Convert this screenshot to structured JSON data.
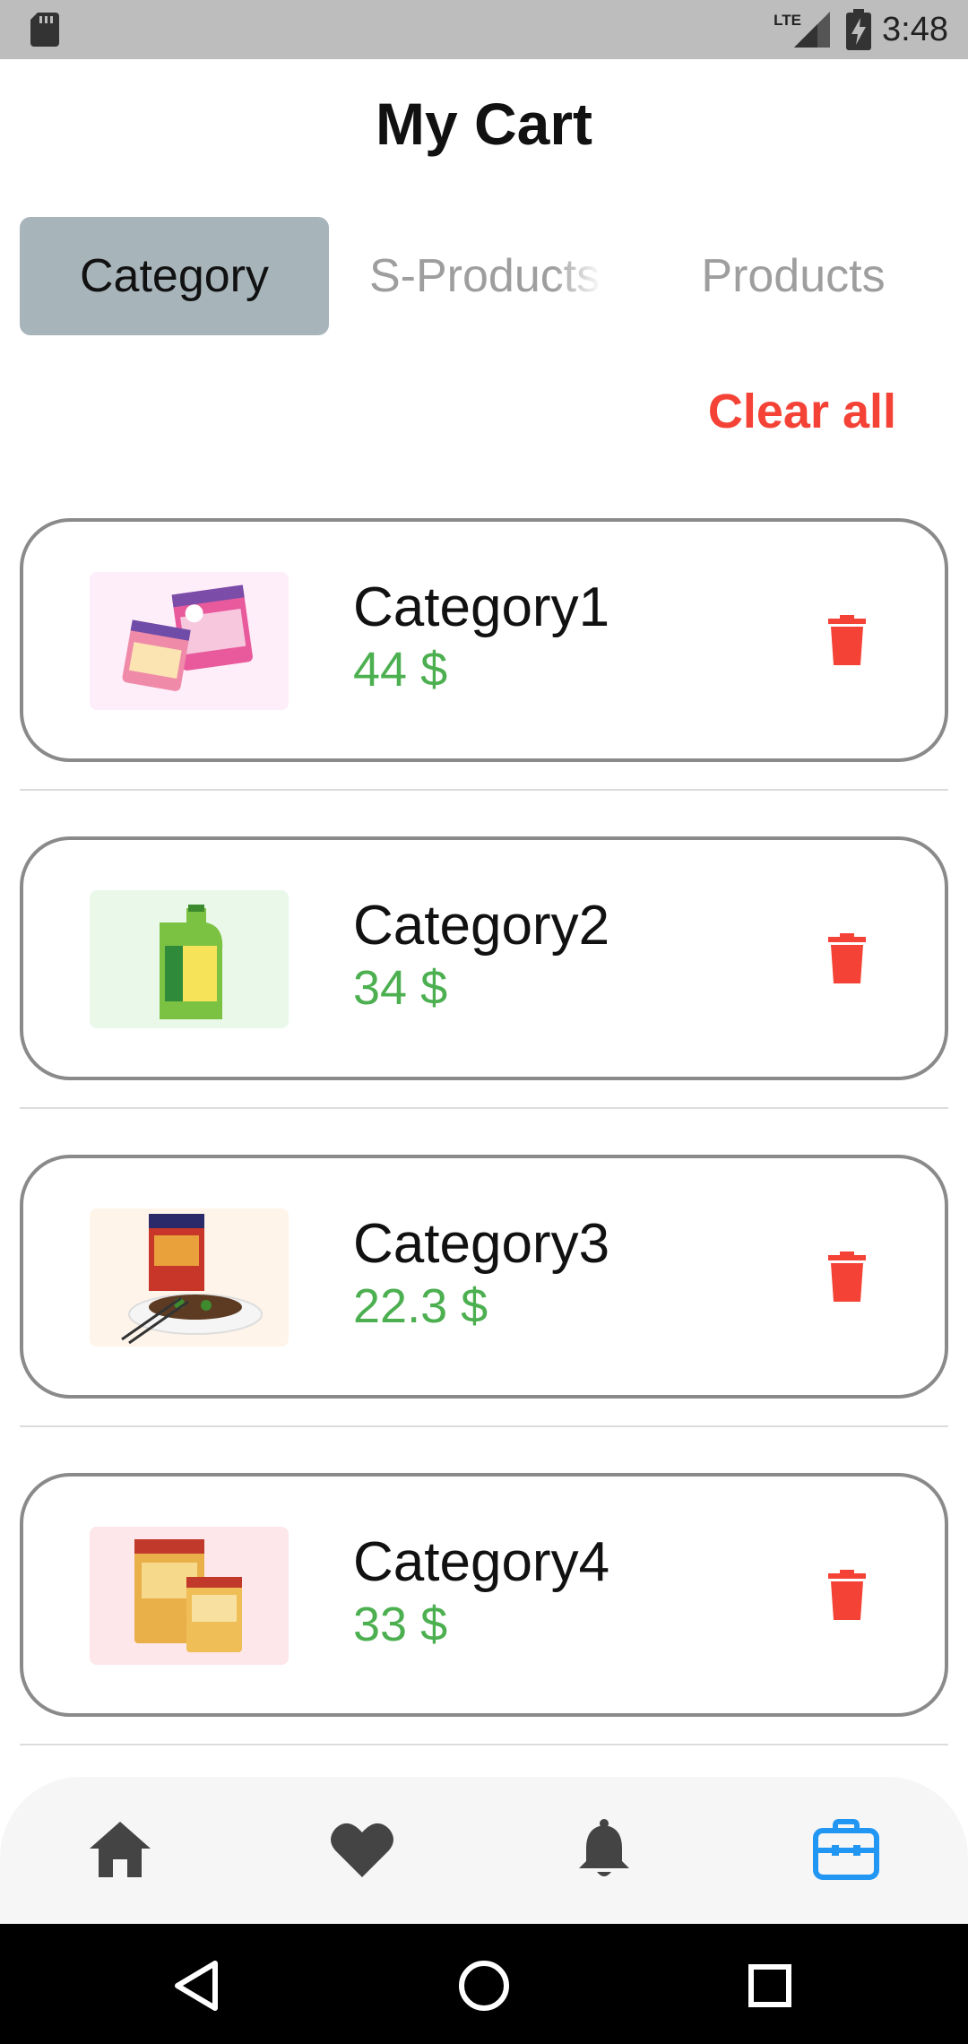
{
  "status_bar": {
    "network": "LTE",
    "time": "3:48"
  },
  "header": {
    "title": "My Cart"
  },
  "tabs": [
    {
      "label": "Category",
      "active": true
    },
    {
      "label": "S-Products",
      "active": false
    },
    {
      "label": "Products",
      "active": false
    }
  ],
  "clear_all_label": "Clear all",
  "cart_items": [
    {
      "title": "Category1",
      "price": "44 $",
      "image": "ice-cream-tubs"
    },
    {
      "title": "Category2",
      "price": "34 $",
      "image": "oil-jerry-can"
    },
    {
      "title": "Category3",
      "price": "22.3 $",
      "image": "noodle-box-plate"
    },
    {
      "title": "Category4",
      "price": "33 $",
      "image": "flour-packs"
    }
  ],
  "bottom_nav": [
    {
      "icon": "home-icon",
      "active": false
    },
    {
      "icon": "heart-icon",
      "active": false
    },
    {
      "icon": "bell-icon",
      "active": false
    },
    {
      "icon": "briefcase-icon",
      "active": true
    }
  ],
  "system_nav": [
    "back-icon",
    "home-circle-icon",
    "recents-icon"
  ],
  "colors": {
    "accent_red": "#f44336",
    "price_green": "#4caf50",
    "active_nav_blue": "#2196f3",
    "tab_active_bg": "#a7b5bb"
  }
}
